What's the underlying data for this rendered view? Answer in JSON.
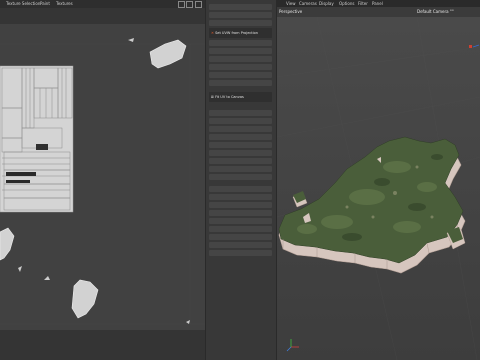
{
  "uv_editor": {
    "menu": [
      "Texture Selection",
      "Paint",
      "Textures"
    ]
  },
  "command_panel": {
    "fit_label": "Fit UV to Canvas",
    "header_label": "Set UVW from Projection",
    "accent_color": "#c8c8c8"
  },
  "viewport": {
    "menu": [
      "View",
      "Cameras",
      "Display",
      "Options",
      "Filter",
      "Panel"
    ],
    "view_name": "Perspective",
    "camera_name": "Default Camera °°",
    "terrain_color": "#4a5e3a",
    "cliff_color": "#d8c8c0"
  }
}
